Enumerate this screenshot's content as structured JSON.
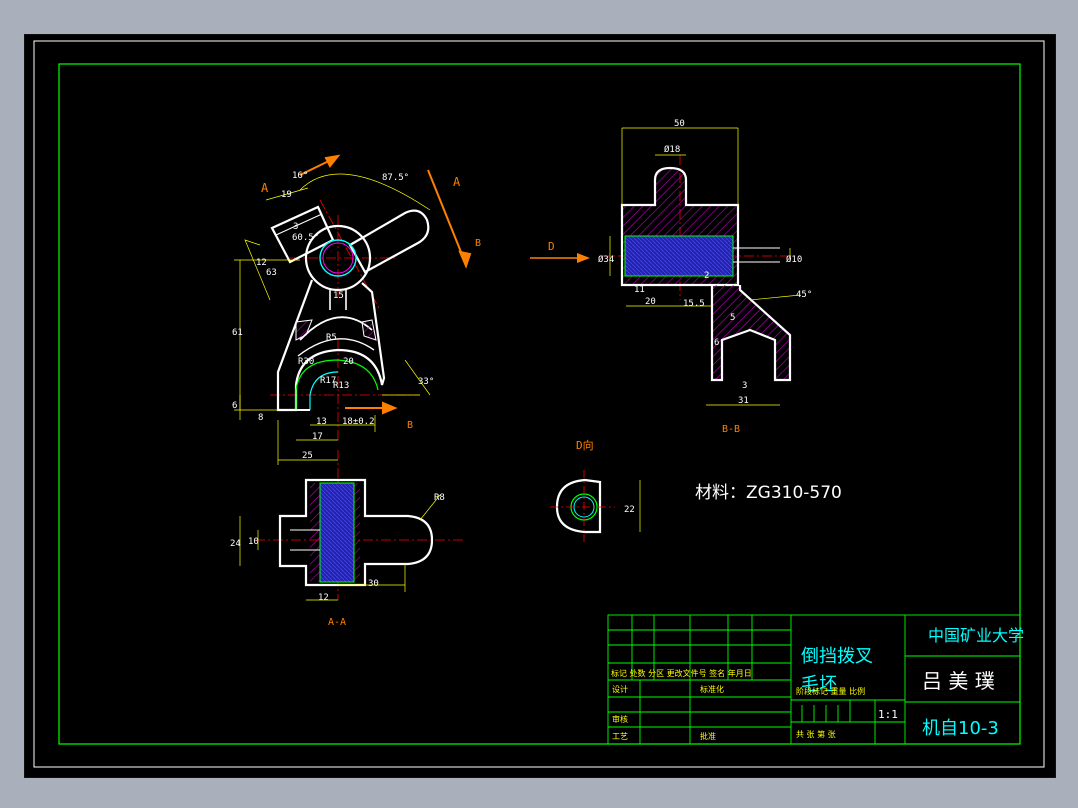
{
  "drawing": {
    "material": "材料：ZG310-570",
    "section_aa": "A-A",
    "section_bb": "B-B",
    "view_d": "D向",
    "label_a": "A",
    "label_b": "B",
    "label_d": "D"
  },
  "dims": {
    "d50": "50",
    "d_phi18": "Ø18",
    "d_phi34": "Ø34",
    "d_phi10": "Ø10",
    "d20": "20",
    "d11": "11",
    "d15_5": "15.5",
    "d45deg": "45°",
    "d6": "6",
    "d2": "2",
    "d5": "5",
    "d3": "3",
    "d31": "31",
    "d16deg": "16°",
    "d87_5deg": "87.5°",
    "d19": "19",
    "d60_5deg": "60.5°",
    "d3a": "3",
    "d12": "12",
    "d63": "63",
    "d61": "61",
    "d6b": "6",
    "d8": "8",
    "d15": "15",
    "dr5": "R5",
    "dr30": "R30",
    "dr17": "R17",
    "dr13": "R13",
    "d20b": "20",
    "d33deg": "33°",
    "d13": "13",
    "d17": "17",
    "d18pm": "18±0.2",
    "d25": "25",
    "d24": "24",
    "d10": "10",
    "dr8": "R8",
    "d30": "30",
    "d12b": "12",
    "d22": "22"
  },
  "title_block": {
    "part_name": "倒挡拨叉",
    "part_sub": "毛坯",
    "university": "中国矿业大学",
    "author": "吕 美 璞",
    "class": "机自10-3",
    "scale": "1:1",
    "row_labels": [
      "标记 处数 分区 更改文件号 签名 年月日",
      "设计",
      "标准化",
      "审核",
      "工艺",
      "批准"
    ],
    "stage_labels": "阶段标记 重量 比例",
    "sheet_labels": "共 张 第 张"
  },
  "colors": {
    "background": "#000000",
    "border": "#00ff00",
    "outline": "#ffffff",
    "dimension": "#ffff00",
    "centerline": "#ff0000",
    "arrow": "#ff8000",
    "hatch": "#ff00ff",
    "fill_blue": "#1e1ea0",
    "title_text": "#00ffff"
  }
}
